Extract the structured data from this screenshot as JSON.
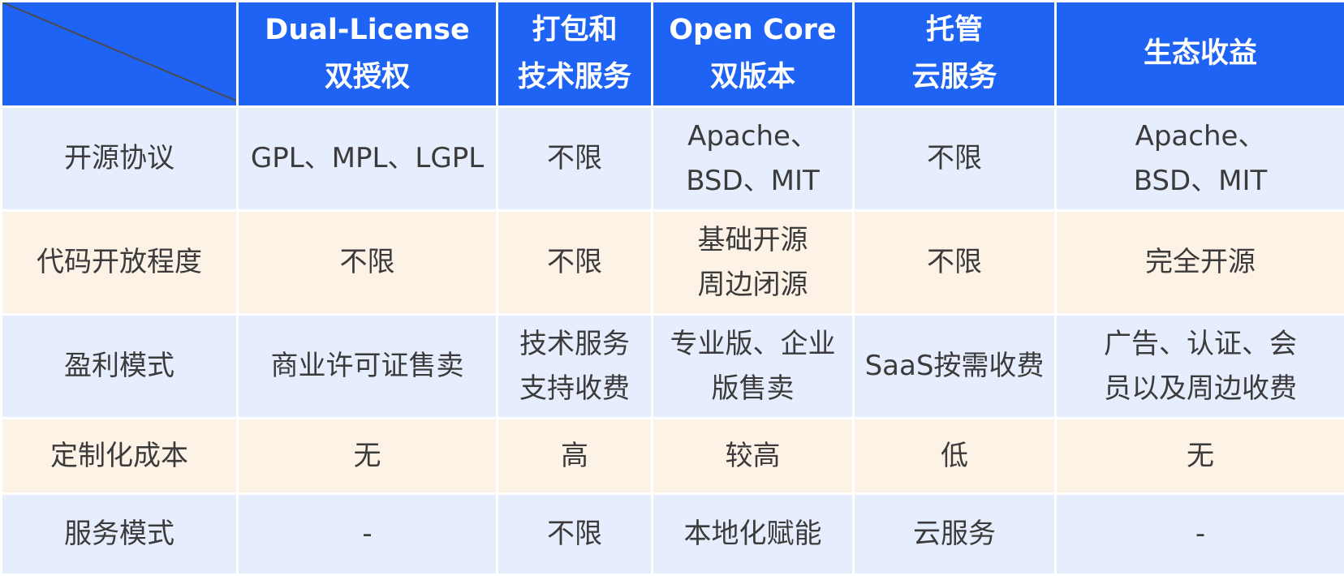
{
  "header": {
    "columns": [
      {
        "lines": [
          "Dual-License",
          "双授权"
        ]
      },
      {
        "lines": [
          "打包和",
          "技术服务"
        ]
      },
      {
        "lines": [
          "Open Core",
          "双版本"
        ]
      },
      {
        "lines": [
          "托管",
          "云服务"
        ]
      },
      {
        "lines": [
          "生态收益"
        ]
      }
    ]
  },
  "rows": [
    {
      "label": "开源协议",
      "cells": [
        [
          "GPL、MPL、LGPL"
        ],
        [
          "不限"
        ],
        [
          "Apache、",
          "BSD、MIT"
        ],
        [
          "不限"
        ],
        [
          "Apache、",
          "BSD、MIT"
        ]
      ]
    },
    {
      "label": "代码开放程度",
      "cells": [
        [
          "不限"
        ],
        [
          "不限"
        ],
        [
          "基础开源",
          "周边闭源"
        ],
        [
          "不限"
        ],
        [
          "完全开源"
        ]
      ]
    },
    {
      "label": "盈利模式",
      "cells": [
        [
          "商业许可证售卖"
        ],
        [
          "技术服务",
          "支持收费"
        ],
        [
          "专业版、企业",
          "版售卖"
        ],
        [
          "SaaS按需收费"
        ],
        [
          "广告、认证、会",
          "员以及周边收费"
        ]
      ]
    },
    {
      "label": "定制化成本",
      "cells": [
        [
          "无"
        ],
        [
          "高"
        ],
        [
          "较高"
        ],
        [
          "低"
        ],
        [
          "无"
        ]
      ]
    },
    {
      "label": "服务模式",
      "cells": [
        [
          "-"
        ],
        [
          "不限"
        ],
        [
          "本地化赋能"
        ],
        [
          "云服务"
        ],
        [
          "-"
        ]
      ]
    }
  ],
  "colors": {
    "header_bg": "#1f63f5",
    "row_blue": "#e6edfc",
    "row_cream": "#fdf2e6",
    "text": "#3b3b3b"
  }
}
